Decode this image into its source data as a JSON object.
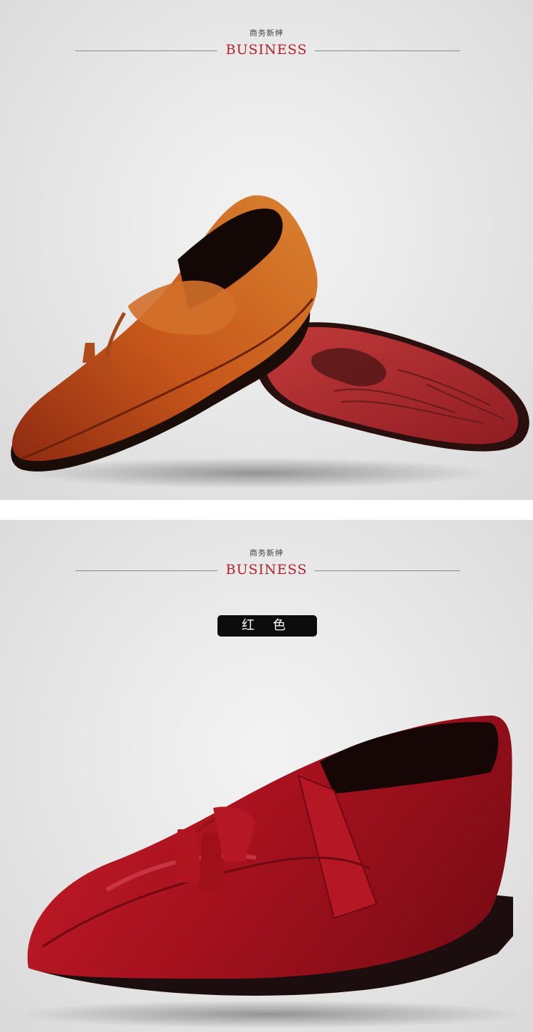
{
  "sections": [
    {
      "subtitle": "商务新绅",
      "title": "BUSINESS",
      "image": "orange-brown-tassel-loafer-with-red-sole"
    },
    {
      "subtitle": "商务新绅",
      "title": "BUSINESS",
      "color_label": "红 色",
      "image": "red-tassel-loafer"
    }
  ],
  "colors": {
    "accent": "#b2212b",
    "badge_bg": "#0c0c0c",
    "shoe_orange": "#c2561b",
    "shoe_red": "#a3111d",
    "sole_red": "#b32b2e"
  }
}
